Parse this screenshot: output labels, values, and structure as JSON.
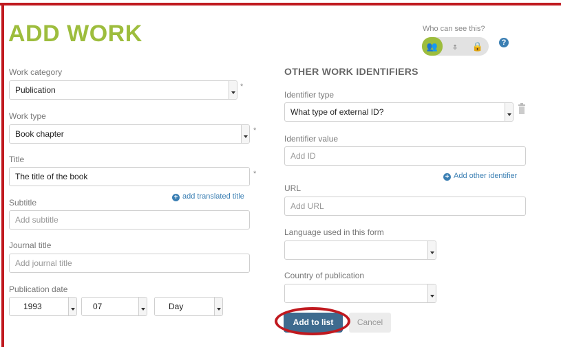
{
  "form": {
    "title": "ADD WORK",
    "visibility": {
      "label": "Who can see this?",
      "options": [
        {
          "icon": "group-icon",
          "glyph": "👥",
          "active": true
        },
        {
          "icon": "trusted-person-icon",
          "glyph": "♁",
          "active": false
        },
        {
          "icon": "lock-icon",
          "glyph": "🔒",
          "active": false
        }
      ],
      "help_glyph": "?"
    },
    "required_marker": "*",
    "left": {
      "work_category": {
        "label": "Work category",
        "value": "Publication"
      },
      "work_type": {
        "label": "Work type",
        "value": "Book chapter"
      },
      "title": {
        "label": "Title",
        "value": "The title of the book"
      },
      "add_translated_title": "add translated title",
      "subtitle": {
        "label": "Subtitle",
        "placeholder": "Add subtitle"
      },
      "journal_title": {
        "label": "Journal title",
        "placeholder": "Add journal title"
      },
      "publication_date": {
        "label": "Publication date",
        "year": "1993",
        "month": "07",
        "day": "Day"
      }
    },
    "right": {
      "section_title": "OTHER WORK IDENTIFIERS",
      "identifier_type": {
        "label": "Identifier type",
        "value": "What type of external ID?"
      },
      "identifier_value": {
        "label": "Identifier value",
        "placeholder": "Add ID"
      },
      "add_other_identifier": "Add other identifier",
      "url": {
        "label": "URL",
        "placeholder": "Add URL"
      },
      "language": {
        "label": "Language used in this form",
        "value": ""
      },
      "country": {
        "label": "Country of publication",
        "value": ""
      }
    },
    "buttons": {
      "add": "Add to list",
      "cancel": "Cancel"
    }
  },
  "colors": {
    "accent_green": "#9dbd3d",
    "link_blue": "#3b7fb3",
    "button_blue": "#3e6b8f",
    "highlight_red": "#c0191f"
  }
}
